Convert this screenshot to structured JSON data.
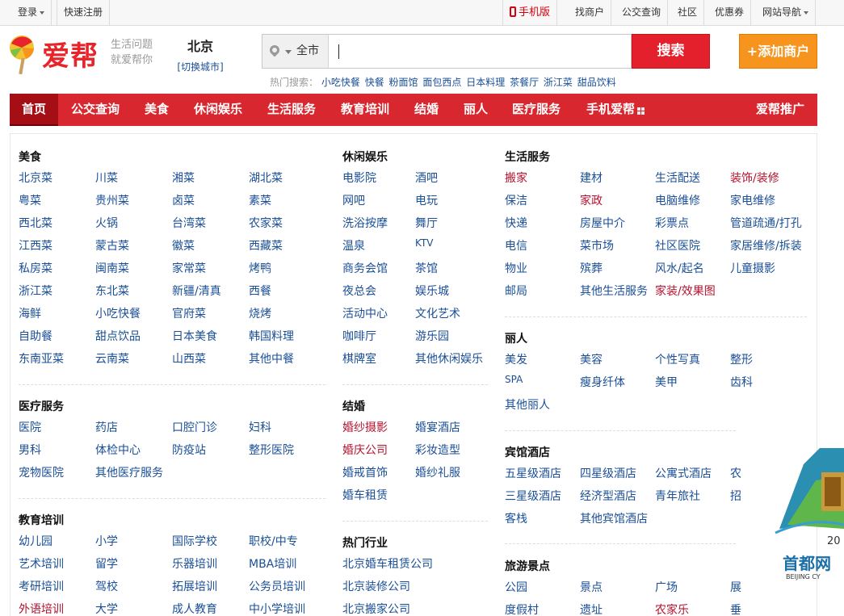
{
  "topbar": {
    "login": "登录",
    "register": "快速注册",
    "mobile": "手机版",
    "find_merchant": "找商户",
    "bus": "公交查询",
    "community": "社区",
    "coupon": "优惠券",
    "site_nav": "网站导航"
  },
  "header": {
    "logo_text": "爱帮",
    "slogan_1": "生活问题",
    "slogan_2": "就爱帮你",
    "city_name": "北京",
    "city_switch": "[切换城市]",
    "search_scope": "全市",
    "search_value": "",
    "search_button": "搜索",
    "add_merchant": "+添加商户",
    "hot_label": "热门搜索：",
    "hot_terms": [
      "小吃快餐",
      "快餐",
      "粉面馆",
      "面包西点",
      "日本料理",
      "茶餐厅",
      "浙江菜",
      "甜品饮料"
    ]
  },
  "nav": [
    "首页",
    "公交查询",
    "美食",
    "休闲娱乐",
    "生活服务",
    "教育培训",
    "结婚",
    "丽人",
    "医疗服务",
    "手机爱帮",
    "爱帮推广"
  ],
  "sections": {
    "food": {
      "title": "美食",
      "items": [
        "北京菜",
        "川菜",
        "湘菜",
        "湖北菜",
        "粤菜",
        "贵州菜",
        "卤菜",
        "素菜",
        "西北菜",
        "火锅",
        "台湾菜",
        "农家菜",
        "江西菜",
        "蒙古菜",
        "徽菜",
        "西藏菜",
        "私房菜",
        "闽南菜",
        "家常菜",
        "烤鸭",
        "浙江菜",
        "东北菜",
        "新疆/清真",
        "西餐",
        "海鲜",
        "小吃快餐",
        "官府菜",
        "烧烤",
        "自助餐",
        "甜点饮品",
        "日本美食",
        "韩国料理",
        "东南亚菜",
        "云南菜",
        "山西菜",
        "其他中餐"
      ]
    },
    "leisure": {
      "title": "休闲娱乐",
      "items": [
        "电影院",
        "酒吧",
        "网吧",
        "电玩",
        "洗浴按摩",
        "舞厅",
        "温泉",
        "KTV",
        "商务会馆",
        "茶馆",
        "夜总会",
        "娱乐城",
        "活动中心",
        "文化艺术",
        "咖啡厅",
        "游乐园",
        "棋牌室",
        "其他休闲娱乐"
      ]
    },
    "life": {
      "title": "生活服务",
      "items": [
        "搬家",
        "建材",
        "生活配送",
        "装饰/装修",
        "保洁",
        "家政",
        "电脑维修",
        "家电维修",
        "快递",
        "房屋中介",
        "彩票点",
        "管道疏通/打孔",
        "电信",
        "菜市场",
        "社区医院",
        "家居维修/拆装",
        "物业",
        "殡葬",
        "风水/起名",
        "儿童摄影",
        "邮局",
        "其他生活服务",
        "家装/效果图"
      ]
    },
    "medical": {
      "title": "医疗服务",
      "items": [
        "医院",
        "药店",
        "口腔门诊",
        "妇科",
        "男科",
        "体检中心",
        "防疫站",
        "整形医院",
        "宠物医院",
        "其他医疗服务"
      ]
    },
    "wedding": {
      "title": "结婚",
      "items": [
        "婚纱摄影",
        "婚宴酒店",
        "婚庆公司",
        "彩妆造型",
        "婚戒首饰",
        "婚纱礼服",
        "婚车租赁"
      ]
    },
    "beauty": {
      "title": "丽人",
      "items": [
        "美发",
        "美容",
        "个性写真",
        "整形",
        "SPA",
        "瘦身纤体",
        "美甲",
        "齿科",
        "其他丽人"
      ]
    },
    "education": {
      "title": "教育培训",
      "items": [
        "幼儿园",
        "小学",
        "国际学校",
        "职校/中专",
        "艺术培训",
        "留学",
        "乐器培训",
        "MBA培训",
        "考研培训",
        "驾校",
        "拓展培训",
        "公务员培训",
        "外语培训",
        "大学",
        "成人教育",
        "中小学培训"
      ]
    },
    "hot": {
      "title": "热门行业",
      "items": [
        "北京婚车租赁公司",
        "北京装修公司",
        "北京搬家公司"
      ]
    },
    "hotel": {
      "title": "宾馆酒店",
      "items": [
        "五星级酒店",
        "四星级酒店",
        "公寓式酒店",
        "农",
        "三星级酒店",
        "经济型酒店",
        "青年旅社",
        "招",
        "客栈",
        "其他宾馆酒店"
      ]
    },
    "travel": {
      "title": "旅游景点",
      "items": [
        "公园",
        "景点",
        "广场",
        "展",
        "度假村",
        "遗址",
        "农家乐",
        "垂"
      ]
    }
  },
  "watermark": {
    "year": "20",
    "name": "首都网",
    "sub": "BEIJING CY"
  },
  "colors": {
    "brand_red": "#d9272f",
    "link_blue": "#1a4f97",
    "highlight": "#b5122f",
    "orange": "#f7941d"
  }
}
